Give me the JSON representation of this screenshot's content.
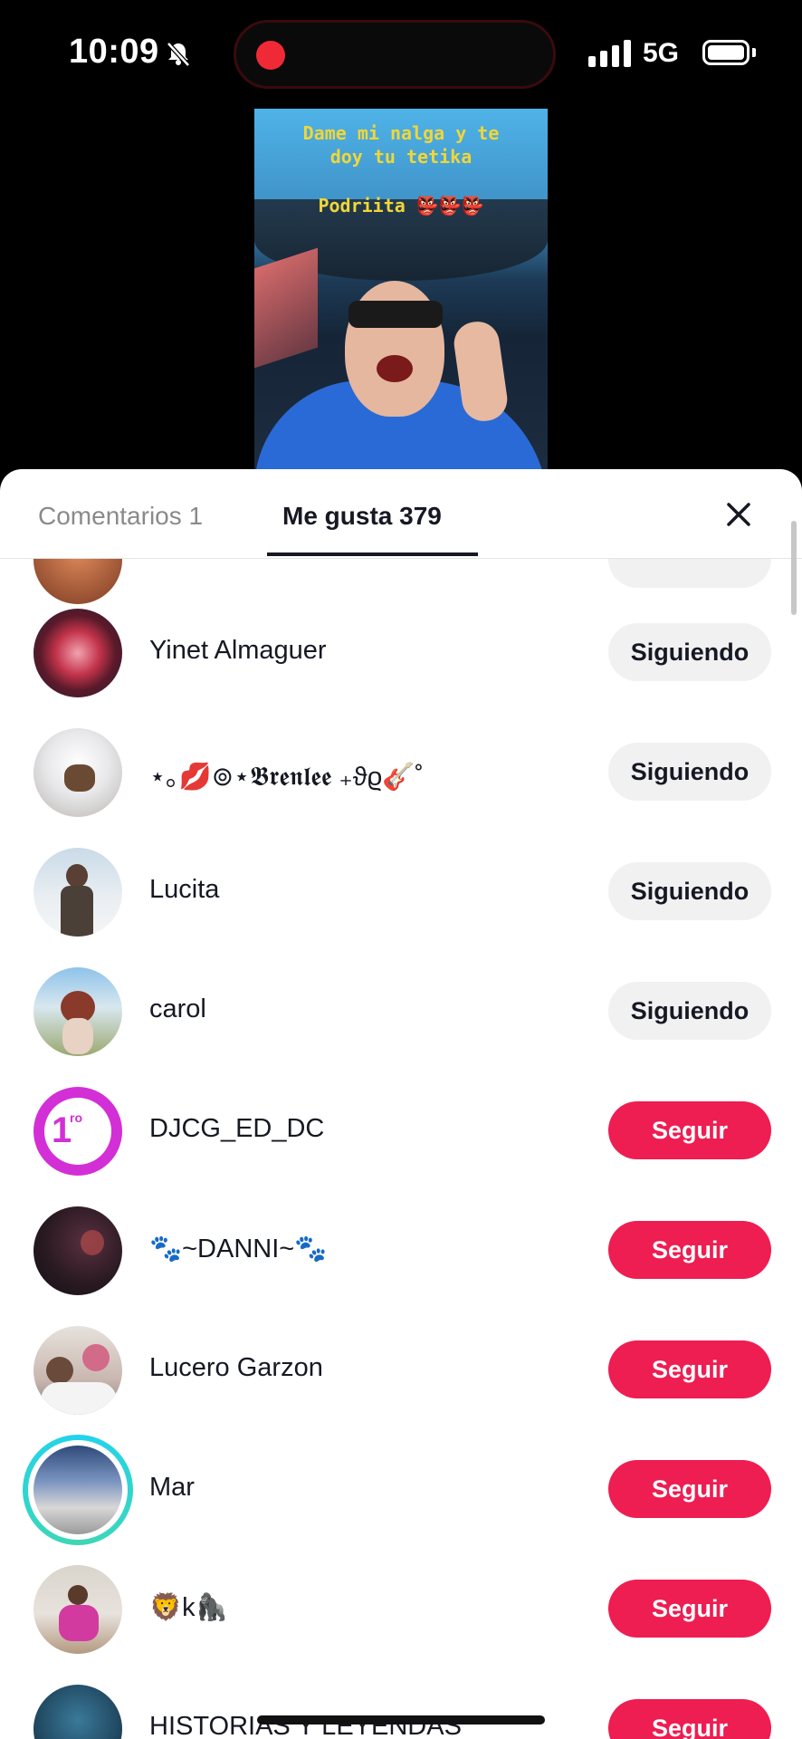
{
  "status_bar": {
    "time": "10:09",
    "network": "5G",
    "icons": [
      "bell-muted-icon",
      "signal-icon",
      "battery-icon"
    ]
  },
  "video": {
    "line1": "Dame mi nalga y te",
    "line2": "doy tu tetika",
    "line3": "Podriita 👺👺👺"
  },
  "tabs": {
    "comments": "Comentarios 1",
    "likes": "Me gusta 379",
    "active": "likes"
  },
  "colors": {
    "follow": "#ee1d52",
    "following_bg": "#f1f1f2",
    "text": "#161823",
    "ring": "#22d3ee"
  },
  "users": [
    {
      "name": "",
      "button": ""
    },
    {
      "name": "Yinet Almaguer",
      "button": "Siguiendo"
    },
    {
      "name": "⋆｡💋⊚⋆𝕭𝖗𝖊𝖓𝖑𝖊𝖊 ₊ϑϱ🎸˚",
      "button": "Siguiendo"
    },
    {
      "name": "Lucita",
      "button": "Siguiendo"
    },
    {
      "name": "carol",
      "button": "Siguiendo"
    },
    {
      "name": "DJCG_ED_DC",
      "button": "Seguir"
    },
    {
      "name": "🐾~DANNI~🐾",
      "button": "Seguir"
    },
    {
      "name": "Lucero Garzon",
      "button": "Seguir"
    },
    {
      "name": "Mar",
      "button": "Seguir"
    },
    {
      "name": "🦁k🦍",
      "button": "Seguir"
    },
    {
      "name": "HISTORIAS Y LEYENDAS",
      "button": "Seguir"
    }
  ]
}
